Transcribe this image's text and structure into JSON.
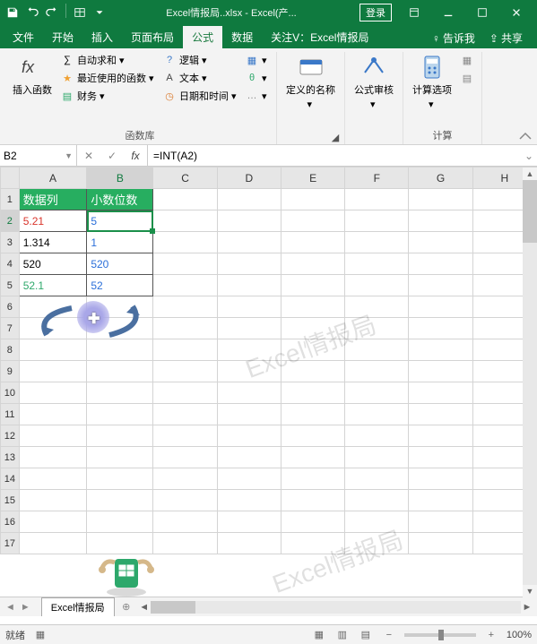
{
  "titlebar": {
    "filename": "Excel情报局..xlsx",
    "app": "Excel(产...",
    "login": "登录"
  },
  "tabs": {
    "file": "文件",
    "home": "开始",
    "insert": "插入",
    "layout": "页面布局",
    "formula": "公式",
    "data": "数据",
    "follow": "关注V：Excel情报局",
    "tell": "告诉我",
    "share": "共享"
  },
  "ribbon": {
    "insert_fn": "插入函数",
    "autosum": "自动求和",
    "recent": "最近使用的函数",
    "finance": "财务",
    "logic": "逻辑",
    "text": "文本",
    "datetime": "日期和时间",
    "fn_lib": "函数库",
    "def_name": "定义的名称",
    "audit": "公式审核",
    "calc_opt": "计算选项",
    "calc": "计算"
  },
  "fxbar": {
    "name": "B2",
    "formula": "=INT(A2)"
  },
  "cols": [
    "A",
    "B",
    "C",
    "D",
    "E",
    "F",
    "G",
    "H"
  ],
  "rows_count": 17,
  "headers": {
    "A": "数据列",
    "B": "小数位数"
  },
  "data": [
    {
      "a": "5.21",
      "acls": "c-red",
      "b": "5",
      "bcls": "c-blue"
    },
    {
      "a": "1.314",
      "acls": "",
      "b": "1",
      "bcls": "c-blue"
    },
    {
      "a": "520",
      "acls": "",
      "b": "520",
      "bcls": "c-blue"
    },
    {
      "a": "52.1",
      "acls": "c-green",
      "b": "52",
      "bcls": "c-blue"
    }
  ],
  "watermark": "Excel情报局",
  "sheet": {
    "name": "Excel情报局"
  },
  "status": {
    "ready": "就绪",
    "zoom": "100%"
  }
}
